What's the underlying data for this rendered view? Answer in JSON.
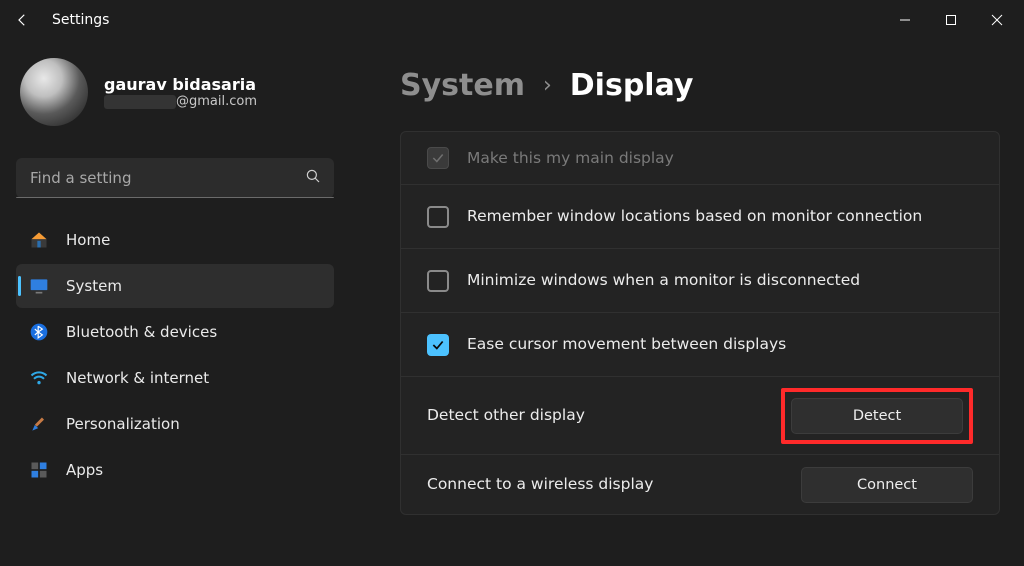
{
  "window": {
    "app_title": "Settings"
  },
  "profile": {
    "name": "gaurav bidasaria",
    "email_domain": "@gmail.com"
  },
  "search": {
    "placeholder": "Find a setting"
  },
  "nav": {
    "home": "Home",
    "system": "System",
    "bluetooth": "Bluetooth & devices",
    "network": "Network & internet",
    "personalization": "Personalization",
    "apps": "Apps"
  },
  "breadcrumb": {
    "parent": "System",
    "separator": "›",
    "current": "Display"
  },
  "settings": {
    "main_display": "Make this my main display",
    "remember_windows": "Remember window locations based on monitor connection",
    "minimize_disconnect": "Minimize windows when a monitor is disconnected",
    "ease_cursor": "Ease cursor movement between displays",
    "detect_label": "Detect other display",
    "detect_button": "Detect",
    "wireless_label": "Connect to a wireless display",
    "wireless_button": "Connect"
  }
}
